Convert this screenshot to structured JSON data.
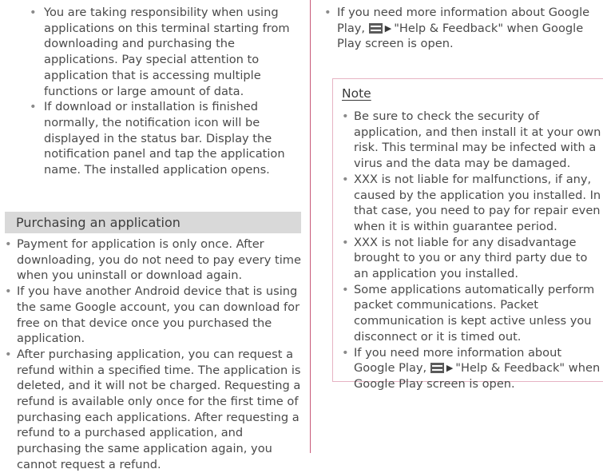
{
  "left": {
    "top_bullets": [
      "You are taking responsibility when using applications on this terminal starting from downloading and purchasing the applications. Pay special attention to application that is accessing multiple functions or large amount of data.",
      "If download or installation is finished normally, the notification icon will be displayed in the status bar. Display the notification panel and tap the application name. The installed application opens."
    ],
    "purchase_heading": "Purchasing an application",
    "purchase_bullets": [
      "Payment for application is only once. After downloading, you do not need to pay every time when you uninstall or download again.",
      "If you have another Android device that is using the same Google account, you can download for free on that device once you purchased the application.",
      "After purchasing application, you can request a refund within a specified time. The application is deleted, and it will not be charged. Requesting a refund is available only once for the first time of purchasing each applications. After requesting a refund to a purchased application, and purchasing the same application again, you cannot request a refund."
    ]
  },
  "right": {
    "top_bullet": {
      "before": "If you need more information about Google Play,",
      "after": "\"Help & Feedback\" when Google Play screen is open."
    },
    "note": {
      "title": "Note",
      "bullets": [
        "Be sure to check the security of application, and then install it at your own risk. This terminal may be infected with a virus and the data may be damaged.",
        "XXX is not liable for malfunctions, if any, caused by the application you installed. In that case, you need to pay for repair even when it is within guarantee period.",
        "XXX is not liable for any disadvantage brought to you or any third party due to an application you installed.",
        "Some applications automatically perform packet communications. Packet communication is kept active unless you disconnect or it is timed out."
      ],
      "last_bullet": {
        "before": "If you need more information about Google Play,",
        "after": "\"Help & Feedback\" when Google Play screen is open."
      }
    }
  },
  "icons": {
    "menu": "menu-icon",
    "arrow": "arrow-right-icon"
  },
  "colors": {
    "divider": "#c8597a",
    "note_border": "#e6b3c3",
    "heading_bg": "#d9d9d9",
    "text": "#4a4a4a"
  }
}
